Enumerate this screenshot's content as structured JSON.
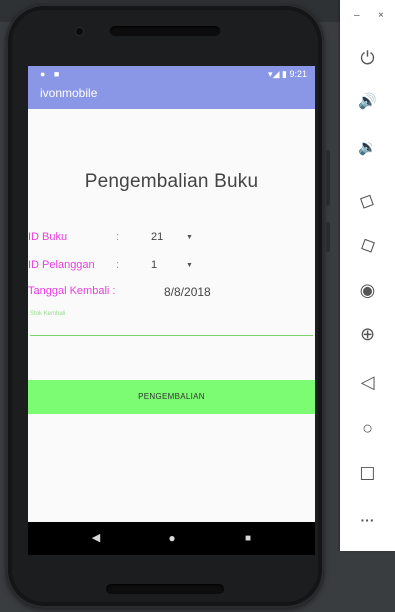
{
  "status_bar": {
    "time": "9:21",
    "left_icons": "● ■",
    "right_icons": "▾◢ ▮"
  },
  "app_bar": {
    "title": "ivonmobile"
  },
  "form": {
    "heading": "Pengembalian Buku",
    "id_buku": {
      "label": "ID Buku",
      "separator": ":",
      "value": "21"
    },
    "id_pelanggan": {
      "label": "ID Pelanggan",
      "separator": ":",
      "value": "1"
    },
    "tanggal_kembali": {
      "label": "Tanggal Kembali :",
      "value": "8/8/2018"
    },
    "denda_hint": "Stok Kembali",
    "submit_label": "PENGEMBALIAN"
  },
  "nav_bar": {
    "back_glyph": "◀",
    "home_glyph": "●",
    "recents_glyph": "■"
  },
  "emulator_toolbar": {
    "minimize_glyph": "–",
    "close_glyph": "×",
    "buttons": [
      {
        "icon": "power-icon",
        "glyph": "⏻"
      },
      {
        "icon": "volume-up-icon",
        "glyph": "🔊"
      },
      {
        "icon": "volume-down-icon",
        "glyph": "🔉"
      },
      {
        "icon": "rotate-left-icon",
        "glyph": "◇"
      },
      {
        "icon": "rotate-right-icon",
        "glyph": "◇"
      },
      {
        "icon": "camera-icon",
        "glyph": "◉"
      },
      {
        "icon": "zoom-icon",
        "glyph": "⊕"
      },
      {
        "icon": "back-icon",
        "glyph": "◁"
      },
      {
        "icon": "home-icon",
        "glyph": "○"
      },
      {
        "icon": "overview-icon",
        "glyph": "☐"
      },
      {
        "icon": "more-icon",
        "glyph": "···"
      }
    ]
  },
  "colors": {
    "app_bar": "#8a96e6",
    "label_magenta": "#e93ee0",
    "button_green": "#7cfc72",
    "underline_green": "#7fd16e"
  }
}
